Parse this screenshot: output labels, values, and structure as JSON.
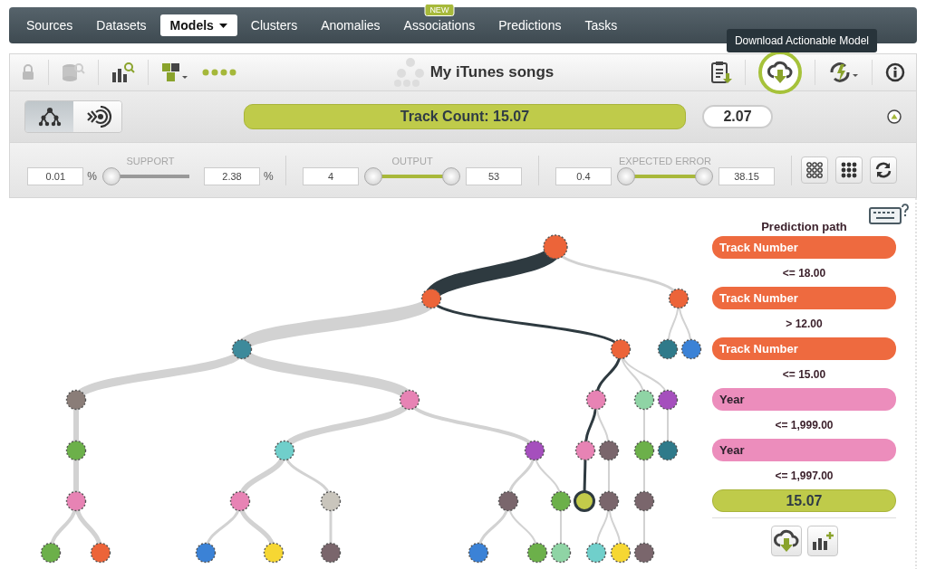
{
  "nav": {
    "tabs": [
      {
        "label": "Sources",
        "selected": false
      },
      {
        "label": "Datasets",
        "selected": false
      },
      {
        "label": "Models",
        "selected": true,
        "dropdown": true
      },
      {
        "label": "Clusters",
        "selected": false
      },
      {
        "label": "Anomalies",
        "selected": false
      },
      {
        "label": "Associations",
        "selected": false,
        "badge": "NEW"
      },
      {
        "label": "Predictions",
        "selected": false
      },
      {
        "label": "Tasks",
        "selected": false
      }
    ]
  },
  "toolbar": {
    "title": "My iTunes songs",
    "tooltip": "Download Actionable Model"
  },
  "view_toggle": [
    {
      "kind": "tree",
      "selected": true
    },
    {
      "kind": "sunburst",
      "selected": false
    }
  ],
  "prediction": {
    "label": "Track Count: 15.07",
    "confidence": "2.07"
  },
  "filters": [
    {
      "label": "SUPPORT",
      "min": "0.01",
      "max": "2.38",
      "min_unit": "%",
      "max_unit": "%",
      "level": 0
    },
    {
      "label": "OUTPUT",
      "min": "4",
      "max": "53",
      "level": 1
    },
    {
      "label": "EXPECTED ERROR",
      "min": "0.4",
      "max": "38.15",
      "level": 1
    }
  ],
  "prediction_path": {
    "title": "Prediction path",
    "steps": [
      {
        "field": "Track Number",
        "color": "#ee6a3f",
        "condition": "<= 18.00"
      },
      {
        "field": "Track Number",
        "color": "#ee6a3f",
        "condition": "> 12.00"
      },
      {
        "field": "Track Number",
        "color": "#ee6a3f",
        "condition": "<= 15.00"
      },
      {
        "field": "Year",
        "color": "#ec8dbc",
        "condition": "<= 1,999.00"
      },
      {
        "field": "Year",
        "color": "#ec8dbc",
        "condition": "<= 1,997.00"
      }
    ],
    "result": "15.07"
  }
}
